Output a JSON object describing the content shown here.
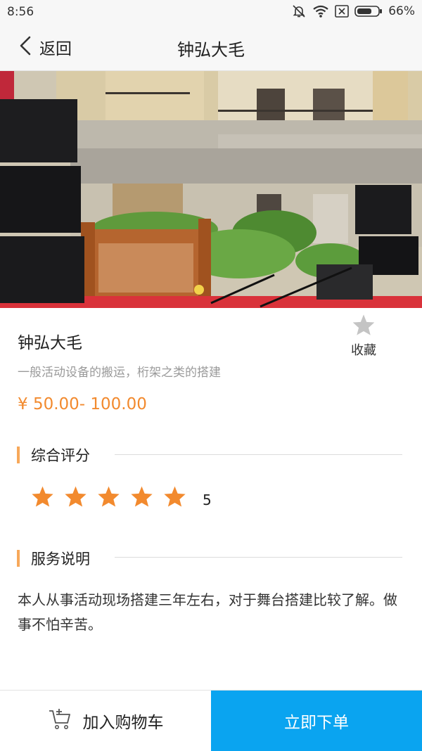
{
  "status_bar": {
    "time": "8:56",
    "battery": "66%"
  },
  "nav": {
    "back_label": "返回",
    "title": "钟弘大毛"
  },
  "service": {
    "title": "钟弘大毛",
    "subtitle": "一般活动设备的搬运，桁架之类的搭建",
    "price": "¥ 50.00- 100.00",
    "favorite_label": "收藏"
  },
  "rating": {
    "title": "综合评分",
    "stars": 5,
    "value": "5"
  },
  "description": {
    "title": "服务说明",
    "text": "本人从事活动现场搭建三年左右，对于舞台搭建比较了解。做事不怕辛苦。"
  },
  "bottom": {
    "cart_label": "加入购物车",
    "order_label": "立即下单"
  },
  "colors": {
    "accent": "#f28a2e",
    "primary": "#0aa4f0",
    "section_bar": "#f7a85a"
  }
}
